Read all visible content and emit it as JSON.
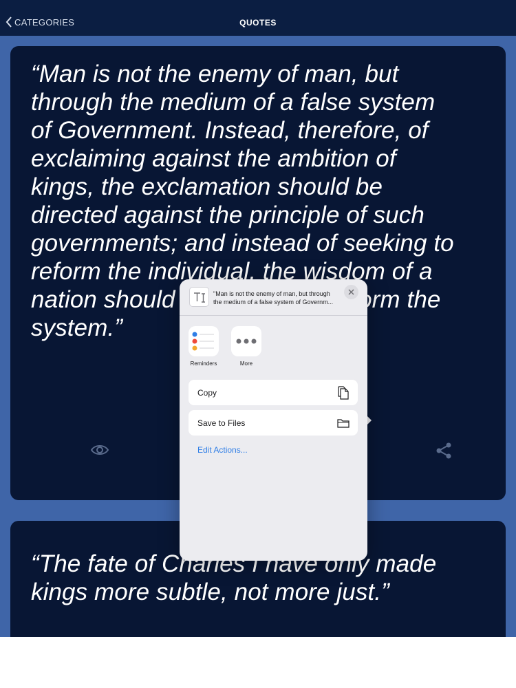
{
  "navbar": {
    "back_label": "CATEGORIES",
    "title": "QUOTES"
  },
  "quotes": [
    {
      "lines": [
        "“Man is not the enemy of man, but",
        "through the medium of a false system",
        "of Government. Instead, therefore, of",
        "exclaiming against the ambition of",
        "kings, the exclamation should be",
        "directed against the principle of such",
        "governments; and instead of seeking to",
        "reform the individual, the wisdom of a",
        "nation should apply itself to reform the",
        "system.”"
      ]
    },
    {
      "lines": [
        "“The fate of Charles I have only made",
        "kings more subtle, not more just.”"
      ]
    }
  ],
  "share_sheet": {
    "preview_line1": "\"Man is not the enemy of man, but through",
    "preview_line2": "the medium of a false system of Governm...",
    "apps": [
      {
        "label": "Reminders",
        "icon": "reminders-icon"
      },
      {
        "label": "More",
        "icon": "more-icon"
      }
    ],
    "actions": [
      {
        "label": "Copy",
        "icon": "copy-icon"
      },
      {
        "label": "Save to Files",
        "icon": "folder-icon"
      }
    ],
    "edit_actions_label": "Edit Actions..."
  },
  "colors": {
    "background": "#3f65a8",
    "navbar": "#0b1e42",
    "card": "#081634",
    "sheet": "#ececf0",
    "link": "#2f7ee6"
  }
}
